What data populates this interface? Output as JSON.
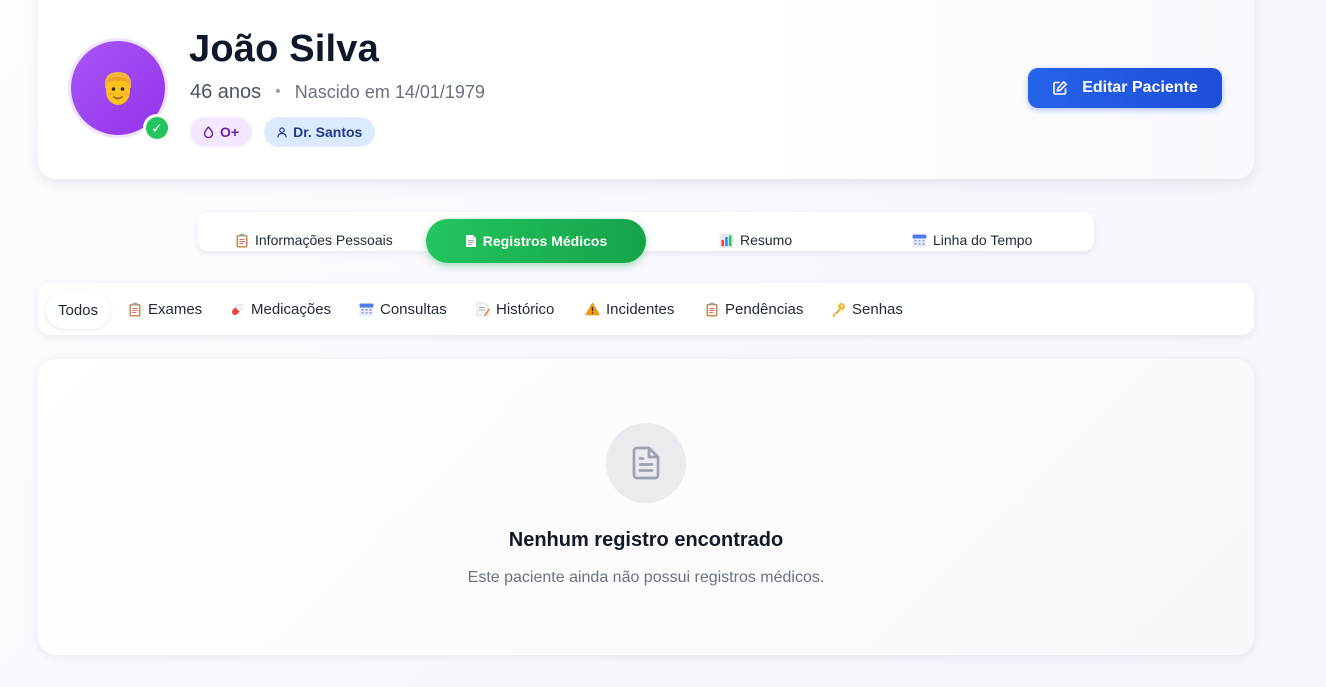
{
  "patient": {
    "name": "João Silva",
    "age": "46 anos",
    "separator": "•",
    "birth": "Nascido em 14/01/1979",
    "verified_mark": "✓",
    "badges": {
      "blood_type": "O+",
      "doctor": "Dr. Santos"
    }
  },
  "actions": {
    "edit_label": "Editar Paciente"
  },
  "main_tabs": [
    {
      "label": "Informações Pessoais",
      "icon": "clipboard-icon"
    },
    {
      "label": "Registros Médicos",
      "icon": "document-icon",
      "active": true
    },
    {
      "label": "Resumo",
      "icon": "bar-chart-icon"
    },
    {
      "label": "Linha do Tempo",
      "icon": "calendar-icon"
    }
  ],
  "filters": [
    {
      "label": "Todos",
      "selected": true
    },
    {
      "label": "Exames",
      "icon": "clipboard-icon"
    },
    {
      "label": "Medicações",
      "icon": "pill-icon"
    },
    {
      "label": "Consultas",
      "icon": "calendar-icon"
    },
    {
      "label": "Histórico",
      "icon": "memo-icon"
    },
    {
      "label": "Incidentes",
      "icon": "warning-icon"
    },
    {
      "label": "Pendências",
      "icon": "clipboard-icon"
    },
    {
      "label": "Senhas",
      "icon": "key-icon"
    }
  ],
  "empty_state": {
    "icon": "file-text-icon",
    "title": "Nenhum registro encontrado",
    "subtitle": "Este paciente ainda não possui registros médicos."
  },
  "colors": {
    "avatar": "#a855f7",
    "verified": "#22c55e",
    "primary": "#2563eb",
    "active_tab": "#22c55e"
  }
}
